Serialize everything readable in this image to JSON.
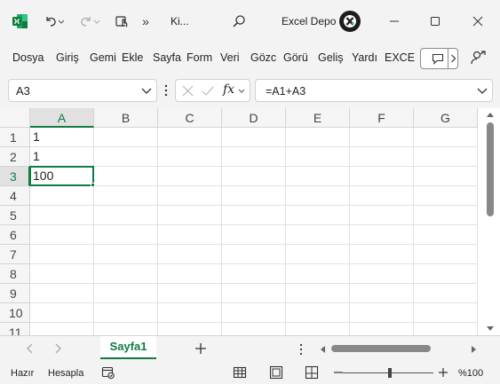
{
  "title": {
    "file_name": "Ki...",
    "app_name": "Excel Depo",
    "avatar_letter": "X"
  },
  "ribbon": {
    "tabs": [
      "Dosya",
      "Giriş",
      "Gemi",
      "Ekle",
      "Sayfa",
      "Form",
      "Veri",
      "Gözc",
      "Görü",
      "Geliş",
      "Yardı",
      "EXCE"
    ]
  },
  "formula_bar": {
    "name_box": "A3",
    "formula": "=A1+A3",
    "fx_label": "fx"
  },
  "grid": {
    "columns": [
      "A",
      "B",
      "C",
      "D",
      "E",
      "F",
      "G"
    ],
    "rows": [
      "1",
      "2",
      "3",
      "4",
      "5",
      "6",
      "7",
      "8",
      "9",
      "10",
      "11"
    ],
    "cells": {
      "A1": "1",
      "A2": "1",
      "A3": "100"
    },
    "selected_cell": "A3"
  },
  "sheets": {
    "active": "Sayfa1"
  },
  "status": {
    "mode": "Hazır",
    "calc": "Hesapla",
    "zoom": "%100"
  },
  "colors": {
    "accent": "#107c41",
    "excel_green": "#107c41"
  }
}
